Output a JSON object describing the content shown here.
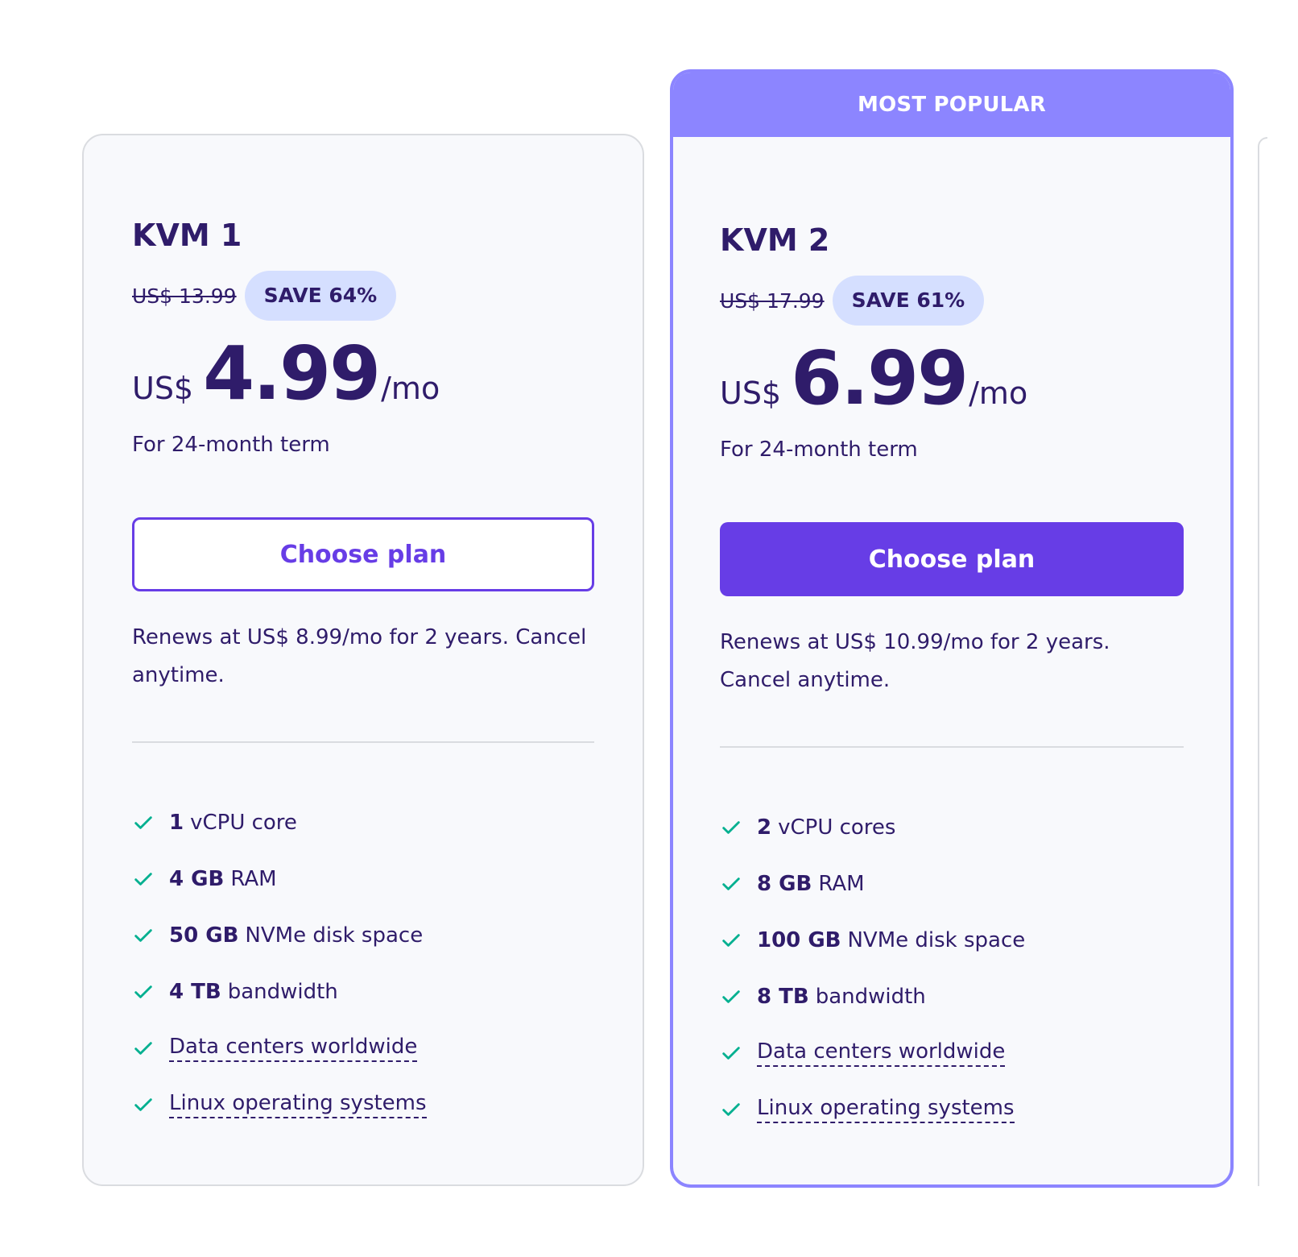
{
  "plans": [
    {
      "name": "KVM 1",
      "old_price": "US$ 13.99",
      "save_badge": "SAVE 64%",
      "currency": "US$",
      "amount": "4.99",
      "per": "/mo",
      "term": "For 24-month term",
      "button_label": "Choose plan",
      "renews": "Renews at US$ 8.99/mo for 2 years. Cancel anytime.",
      "features": [
        {
          "bold": "1",
          "text": "vCPU core"
        },
        {
          "bold": "4 GB",
          "text": "RAM"
        },
        {
          "bold": "50 GB",
          "text": "NVMe disk space"
        },
        {
          "bold": "4 TB",
          "text": "bandwidth"
        },
        {
          "text": "Data centers worldwide"
        },
        {
          "text": "Linux operating systems"
        }
      ]
    },
    {
      "banner": "MOST POPULAR",
      "name": "KVM 2",
      "old_price": "US$ 17.99",
      "save_badge": "SAVE 61%",
      "currency": "US$",
      "amount": "6.99",
      "per": "/mo",
      "term": "For 24-month term",
      "button_label": "Choose plan",
      "renews": "Renews at US$ 10.99/mo for 2 years. Cancel anytime.",
      "features": [
        {
          "bold": "2",
          "text": "vCPU cores"
        },
        {
          "bold": "8 GB",
          "text": "RAM"
        },
        {
          "bold": "100 GB",
          "text": "NVMe disk space"
        },
        {
          "bold": "8 TB",
          "text": "bandwidth"
        },
        {
          "text": "Data centers worldwide"
        },
        {
          "text": "Linux operating systems"
        }
      ]
    }
  ],
  "colors": {
    "text": "#2f1c6a",
    "accent": "#673de6",
    "banner": "#8c85ff",
    "badge_bg": "#d5dfff",
    "check": "#00b090"
  }
}
